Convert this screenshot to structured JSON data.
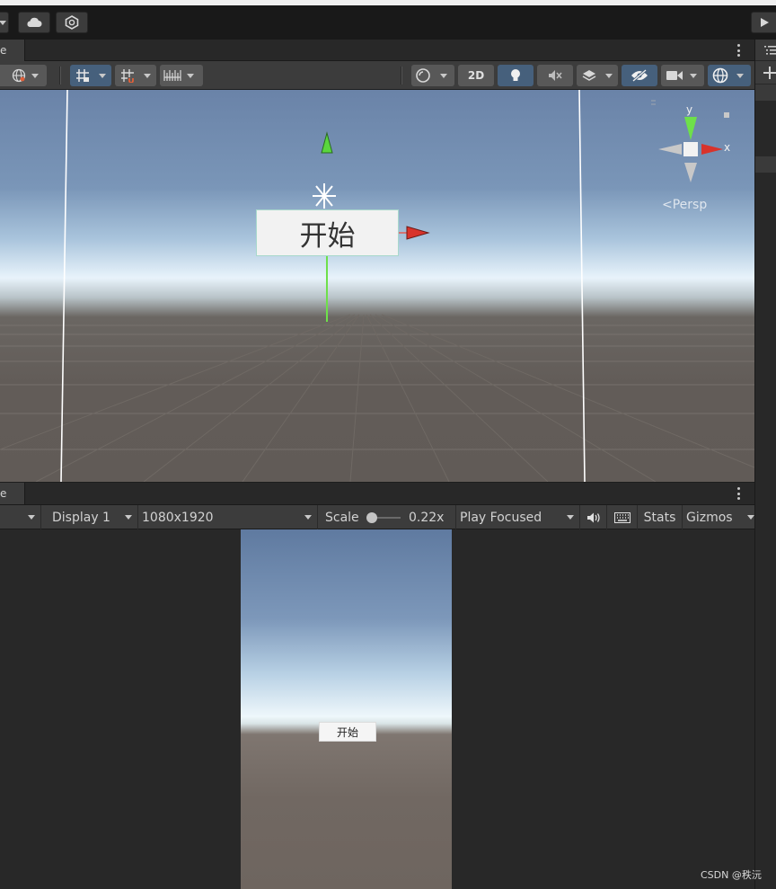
{
  "scene": {
    "tab_label": "e",
    "toolbar": {
      "mode_2d_label": "2D"
    },
    "ui_button_text": "开始",
    "gizmo": {
      "axis_y": "y",
      "axis_x": "x",
      "persp_label": "<Persp"
    }
  },
  "game": {
    "tab_label": "e",
    "display_label": "Display 1",
    "resolution_label": "1080x1920",
    "scale_label": "Scale",
    "scale_value": "0.22x",
    "play_mode_label": "Play Focused",
    "stats_label": "Stats",
    "gizmos_label": "Gizmos",
    "ui_button_text": "开始"
  },
  "watermark": "CSDN @秩沅",
  "colors": {
    "panel": "#3c3c3c",
    "active_button": "#46607c",
    "axis_x": "#d8332b",
    "axis_y": "#6ee04a"
  }
}
